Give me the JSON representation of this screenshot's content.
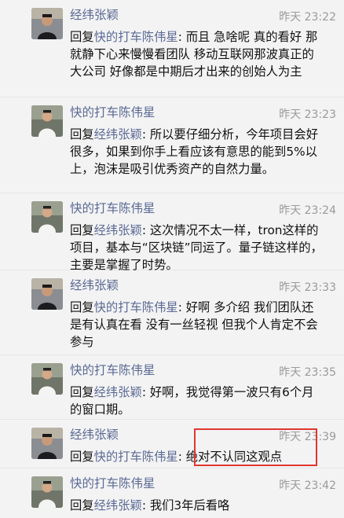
{
  "messages": [
    {
      "avatar": "avatar-man-dark-clothes",
      "name": "经纬张颖",
      "time": "昨天 23:22",
      "reply_prefix": "回复",
      "reply_to": "快的打车陈伟星",
      "text": ": 而且 急啥呢 真的看好 那就静下心来慢慢看团队 移动互联网那波真正的大公司 好像都是中期后才出来的创始人为主"
    },
    {
      "avatar": "avatar-man-white-shirt",
      "name": "快的打车陈伟星",
      "time": "昨天 23:23",
      "reply_prefix": "回复",
      "reply_to": "经纬张颖",
      "text": ": 所以要仔细分析，今年项目会好很多，如果到你手上看应该有意思的能到5%以上，泡沫是吸引优秀资产的自然力量。"
    },
    {
      "avatar": "avatar-man-white-shirt",
      "name": "快的打车陈伟星",
      "time": "昨天 23:24",
      "reply_prefix": "回复",
      "reply_to": "经纬张颖",
      "text": ": 这次情况不太一样，tron这样的项目，基本与“区块链”同运了。量子链这样的，主要是掌握了时势。"
    },
    {
      "avatar": "avatar-man-dark-clothes",
      "name": "经纬张颖",
      "time": "昨天 23:33",
      "reply_prefix": "回复",
      "reply_to": "快的打车陈伟星",
      "text": ": 好啊 多介绍 我们团队还是有认真在看 没有一丝轻视 但我个人肯定不会参与"
    },
    {
      "avatar": "avatar-man-white-shirt",
      "name": "快的打车陈伟星",
      "time": "昨天 23:35",
      "reply_prefix": "回复",
      "reply_to": "经纬张颖",
      "text": ": 好啊，我觉得第一波只有6个月的窗口期。"
    },
    {
      "avatar": "avatar-man-dark-clothes",
      "name": "经纬张颖",
      "time": "昨天 23:39",
      "reply_prefix": "回复",
      "reply_to": "快的打车陈伟星",
      "text": ": 绝对不认同这观点"
    },
    {
      "avatar": "avatar-man-white-shirt",
      "name": "快的打车陈伟星",
      "time": "昨天 23:42",
      "reply_prefix": "回复",
      "reply_to": "经纬张颖",
      "text": ": 我们3年后看咯"
    }
  ],
  "colors": {
    "background": "#f3f3f4",
    "name": "#5b6a94",
    "time": "#9a9a9a",
    "highlight_box": "#e0362f"
  }
}
